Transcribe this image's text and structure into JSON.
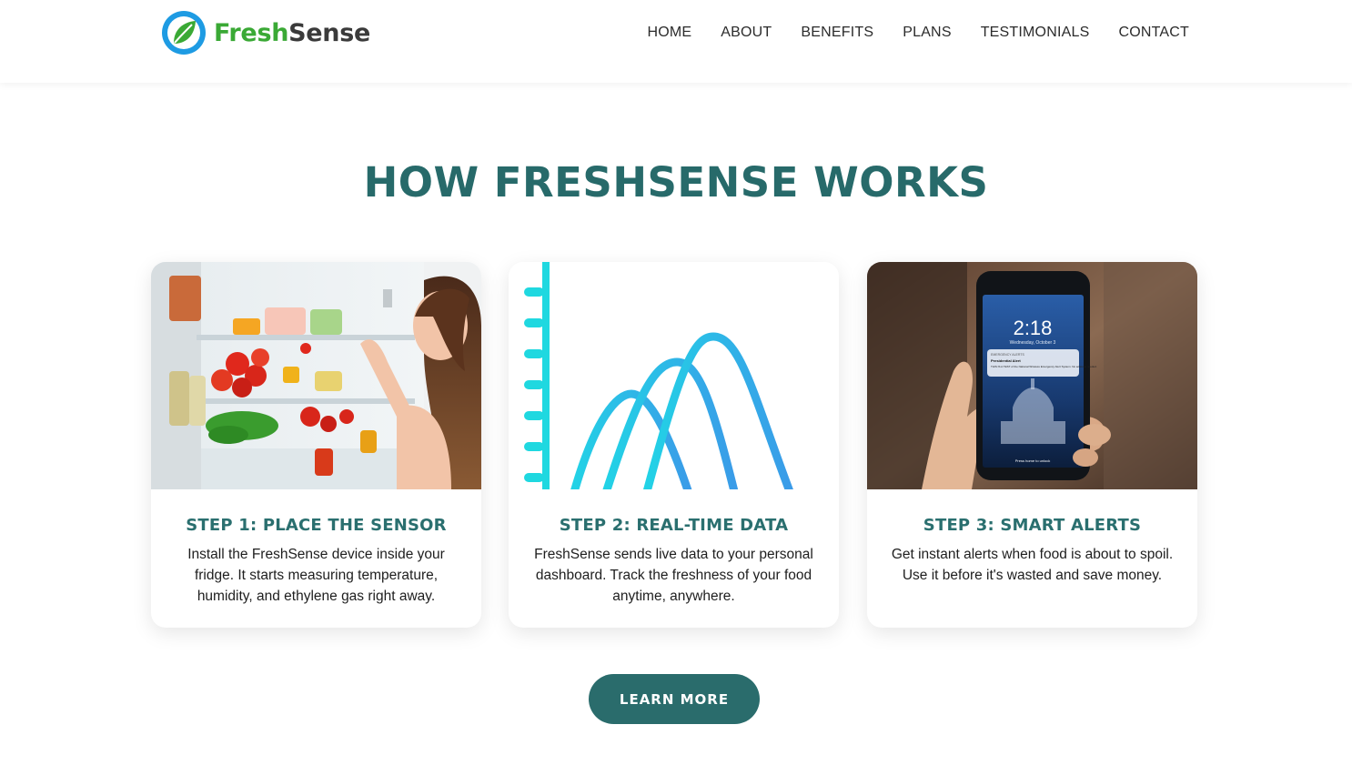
{
  "brand": {
    "name_part1": "Fresh",
    "name_part2": "Sense",
    "logo_icon": "leaf-icon",
    "colors": {
      "green": "#3aa935",
      "blue": "#1e9be3",
      "dark_text": "#3a3a3a"
    }
  },
  "nav": {
    "items": [
      {
        "label": "HOME"
      },
      {
        "label": "ABOUT"
      },
      {
        "label": "BENEFITS"
      },
      {
        "label": "PLANS"
      },
      {
        "label": "TESTIMONIALS"
      },
      {
        "label": "CONTACT"
      }
    ]
  },
  "section": {
    "title": "HOW FRESHSENSE WORKS",
    "accent_color": "#276a6a"
  },
  "steps": [
    {
      "title": "STEP 1: PLACE THE SENSOR",
      "text": "Install the FreshSense device inside your fridge. It starts measuring temperature, humidity, and ethylene gas right away.",
      "image": "woman-opening-fridge-photo"
    },
    {
      "title": "STEP 2: REAL-TIME DATA",
      "text": "FreshSense sends live data to your personal dashboard. Track the freshness of your food anytime, anywhere.",
      "image": "bell-curve-chart-illustration"
    },
    {
      "title": "STEP 3: SMART ALERTS",
      "text": "Get instant alerts when food is about to spoil. Use it before it's wasted and save money.",
      "image": "phone-lockscreen-alert-photo",
      "phone_screen": {
        "time": "2:18",
        "date": "Wednesday, October 3",
        "alert_header": "EMERGENCY ALERTS",
        "alert_title": "Presidential Alert",
        "alert_body": "THIS IS A TEST of the National Wireless Emergency Alert System. No action is needed.",
        "unlock_hint": "Press home to unlock"
      }
    }
  ],
  "cta": {
    "label": "LEARN MORE",
    "color": "#2a6c6c"
  }
}
